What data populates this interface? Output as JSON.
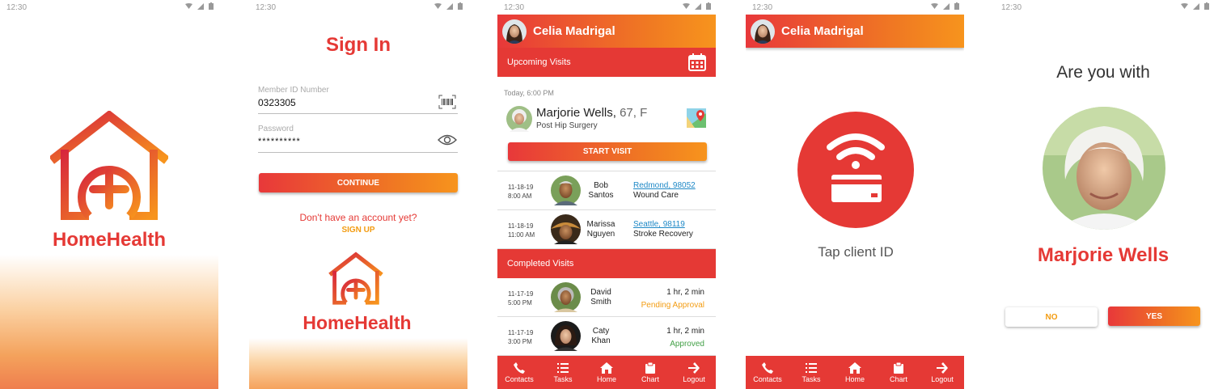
{
  "status": {
    "time": "12:30"
  },
  "screen1": {
    "brand": "HomeHealth"
  },
  "screen2": {
    "title": "Sign In",
    "member_label": "Member ID Number",
    "member_value": "0323305",
    "password_label": "Password",
    "password_value": "**********",
    "continue_label": "CONTINUE",
    "no_account": "Don't have an account yet?",
    "signup_label": "SIGN UP",
    "brand": "HomeHealth"
  },
  "screen3": {
    "user_name": "Celia Madrigal",
    "upcoming_label": "Upcoming Visits",
    "featured": {
      "time": "Today, 6:00 PM",
      "name": "Marjorie Wells,",
      "age_sex": "67, F",
      "reason": "Post Hip Surgery",
      "start_label": "START VISIT"
    },
    "upcoming": [
      {
        "date": "11-18-19",
        "time": "8:00 AM",
        "first": "Bob",
        "last": "Santos",
        "location": "Redmond, 98052",
        "reason": "Wound Care"
      },
      {
        "date": "11-18-19",
        "time": "11:00 AM",
        "first": "Marissa",
        "last": "Nguyen",
        "location": "Seattle, 98119",
        "reason": "Stroke Recovery"
      }
    ],
    "completed_label": "Completed Visits",
    "completed": [
      {
        "date": "11-17-19",
        "time": "5:00 PM",
        "first": "David",
        "last": "Smith",
        "duration": "1 hr, 2 min",
        "status": "Pending Approval"
      },
      {
        "date": "11-17-19",
        "time": "3:00 PM",
        "first": "Caty",
        "last": "Khan",
        "duration": "1 hr, 2 min",
        "status": "Approved"
      }
    ]
  },
  "nav": {
    "contacts": "Contacts",
    "tasks": "Tasks",
    "home": "Home",
    "chart": "Chart",
    "logout": "Logout"
  },
  "screen4": {
    "user_name": "Celia Madrigal",
    "tap_label": "Tap client ID"
  },
  "screen5": {
    "question": "Are you with",
    "name": "Marjorie Wells",
    "no_label": "NO",
    "yes_label": "YES"
  },
  "colors": {
    "primary": "#e53935",
    "accent": "#f7941d",
    "pending": "#f39c12",
    "approved": "#43a047",
    "link": "#1e88c6"
  }
}
